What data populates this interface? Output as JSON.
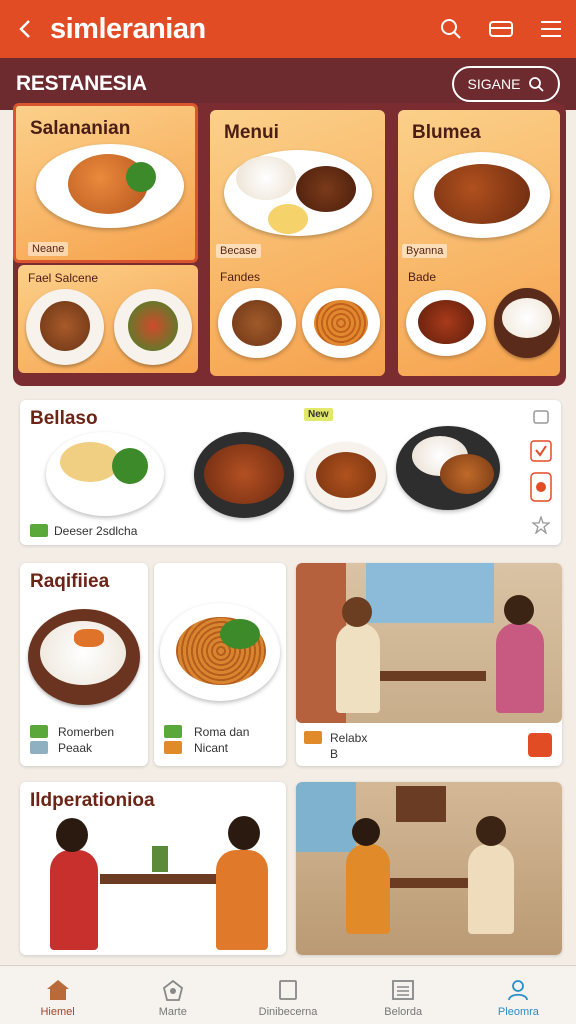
{
  "app": {
    "title": "simleranian"
  },
  "section": {
    "title": "RESTANESIA",
    "search_label": "SIGANE"
  },
  "menu_cards": [
    {
      "title": "Salananian",
      "tag": "Neane",
      "subtitle": "Fael Salcene"
    },
    {
      "title": "Menui",
      "tag": "Becase",
      "subtitle": "Fandes"
    },
    {
      "title": "Blumea",
      "tag": "Byanna",
      "subtitle": "Bade"
    }
  ],
  "featured": {
    "title": "Bellaso",
    "badge": "New",
    "caption": "Deeser 2sdlcha"
  },
  "cards": [
    {
      "title": "Raqifiiea",
      "line1": "Romerben",
      "line2": "Peaak"
    },
    {
      "line1": "Roma dan",
      "line2": "Nicant"
    },
    {
      "line1": "Relabx",
      "line2": "B"
    },
    {
      "title": "Ildperationioa"
    }
  ],
  "bottom_nav": [
    {
      "label": "Hiemel",
      "icon": "home-icon"
    },
    {
      "label": "Marte",
      "icon": "map-icon"
    },
    {
      "label": "Dinibecerna",
      "icon": "square-icon"
    },
    {
      "label": "Belorda",
      "icon": "list-icon"
    },
    {
      "label": "Pleomra",
      "icon": "profile-icon"
    }
  ],
  "colors": {
    "primary": "#e24c25",
    "band": "#6d2a2f",
    "panel": "#7b2c30",
    "active": "#2a8fc9"
  }
}
